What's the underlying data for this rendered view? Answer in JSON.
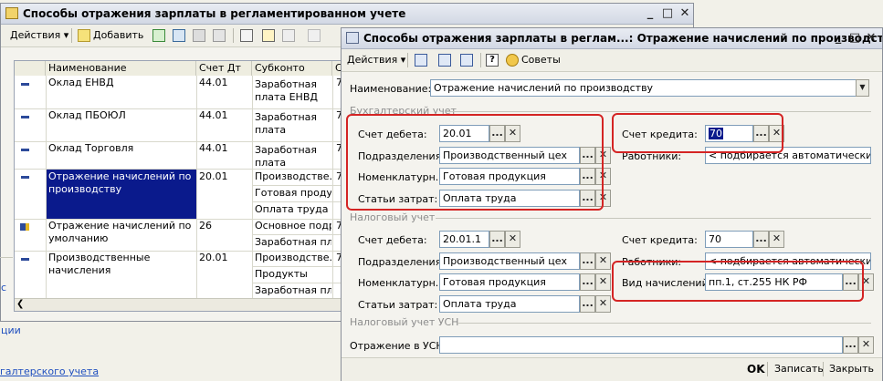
{
  "main_window": {
    "title": "Способы отражения зарплаты в регламентированном учете",
    "toolbar": {
      "actions_label": "Действия",
      "add_label": "Добавить"
    },
    "columns": [
      "Наименование",
      "Счет Дт",
      "Субконто",
      "С"
    ],
    "rows": [
      {
        "name": "Оклад ЕНВД",
        "account": "44.01",
        "subconto": [
          "Заработная плата ЕНВД"
        ],
        "col4": "7"
      },
      {
        "name": "Оклад ПБОЮЛ",
        "account": "44.01",
        "subconto": [
          "Заработная плата"
        ],
        "col4": "7"
      },
      {
        "name": "Оклад Торговля",
        "account": "44.01",
        "subconto": [
          "Заработная плата"
        ],
        "col4": "7"
      },
      {
        "name": "Отражение начислений по производству",
        "account": "20.01",
        "subconto": [
          "Производстве...",
          "Готовая проду...",
          "Оплата труда"
        ],
        "col4": "7"
      },
      {
        "name": "Отражение начислений по умолчанию",
        "account": "26",
        "subconto": [
          "Основное подр...",
          "Заработная пл..."
        ],
        "col4": "7"
      },
      {
        "name": "Производственные начисления",
        "account": "20.01",
        "subconto": [
          "Производстве...",
          "Продукты",
          "Заработная пл..."
        ],
        "col4": "7"
      }
    ],
    "side_texts": {
      "a": "с",
      "b": "ции",
      "c": "галтерского учета"
    }
  },
  "dialog": {
    "title": "Способы отражения зарплаты в реглам...: Отражение начислений по производству",
    "toolbar": {
      "actions_label": "Действия",
      "advice_label": "Советы",
      "help_label": "?"
    },
    "name_label": "Наименование:",
    "name_value": "Отражение начислений по производству",
    "accounting": {
      "section_label": "Бухгалтерский учет",
      "debit_label": "Счет дебета:",
      "debit_value": "20.01",
      "division_label": "Подразделения:",
      "division_value": "Производственный цех",
      "nomenclature_label": "Номенклатурн...",
      "nomenclature_value": "Готовая продукция",
      "cost_label": "Статьи затрат:",
      "cost_value": "Оплата труда",
      "credit_label": "Счет кредита:",
      "credit_value": "70",
      "workers_label": "Работники:",
      "workers_value": "< подбирается автоматически >"
    },
    "tax": {
      "section_label": "Налоговый учет",
      "debit_label": "Счет дебета:",
      "debit_value": "20.01.1",
      "division_label": "Подразделения:",
      "division_value": "Производственный цех",
      "nomenclature_label": "Номенклатурн...",
      "nomenclature_value": "Готовая продукция",
      "cost_label": "Статьи затрат:",
      "cost_value": "Оплата труда",
      "credit_label": "Счет кредита:",
      "credit_value": "70",
      "workers_label": "Работники:",
      "workers_value": "< подбирается автоматически >",
      "accrual_label": "Вид начислений:",
      "accrual_value": "пп.1, ст.255 НК РФ"
    },
    "usn": {
      "section_label": "Налоговый учет УСН",
      "reflection_label": "Отражение в УСН:",
      "reflection_value": ""
    },
    "buttons": {
      "ok": "OK",
      "save": "Записать",
      "close": "Закрыть"
    }
  },
  "colors": {
    "selection": "#0a1a8c",
    "highlight": "#d42424"
  },
  "icons": [
    "save-icon",
    "add-icon",
    "copy-icon",
    "edit-icon",
    "delete-icon",
    "filter-icon",
    "help-icon",
    "advice-icon"
  ]
}
